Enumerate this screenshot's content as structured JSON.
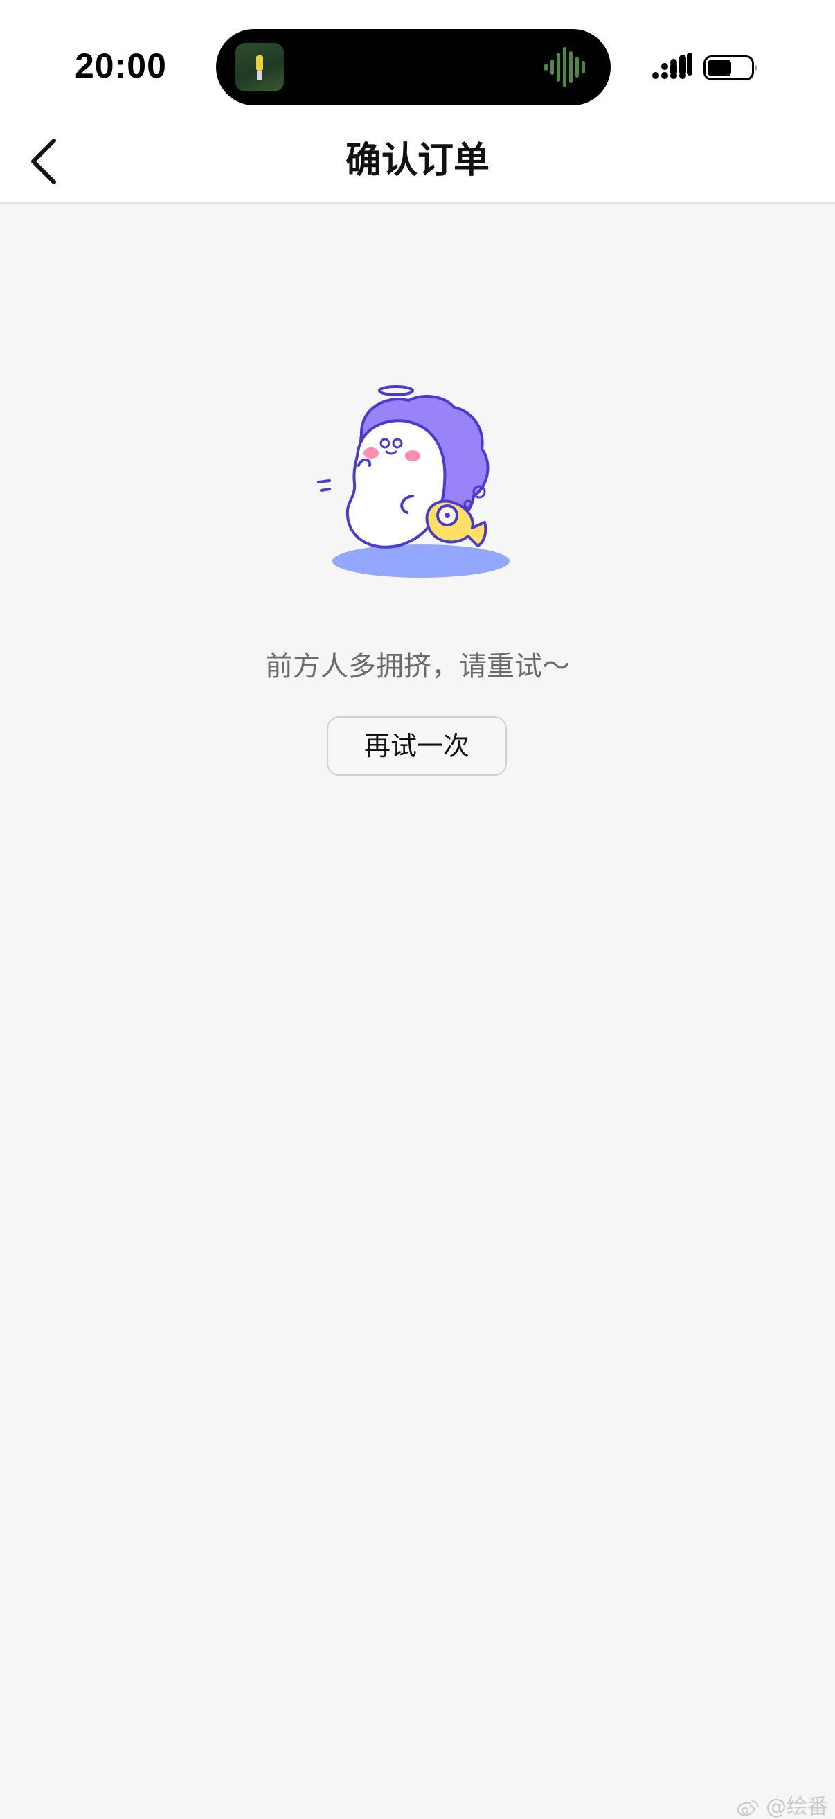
{
  "status_bar": {
    "time": "20:00",
    "icons": [
      "now-playing-thumbnail",
      "audio-waveform-icon",
      "signal-icon",
      "battery-icon"
    ],
    "waveform_color": "#4c8a3d"
  },
  "nav": {
    "back_icon": "chevron-left-icon",
    "title": "确认订单"
  },
  "empty_state": {
    "illustration": "crowded-mascot-illustration",
    "message": "前方人多拥挤，请重试～",
    "retry_label": "再试一次"
  },
  "colors": {
    "background": "#f6f6f6",
    "mascot_purple": "#9a82f8",
    "mascot_outline": "#4a3bcf",
    "fish_yellow": "#ffe064",
    "shadow_blue": "#94a7ff"
  },
  "watermark": {
    "text": "@绘番"
  }
}
